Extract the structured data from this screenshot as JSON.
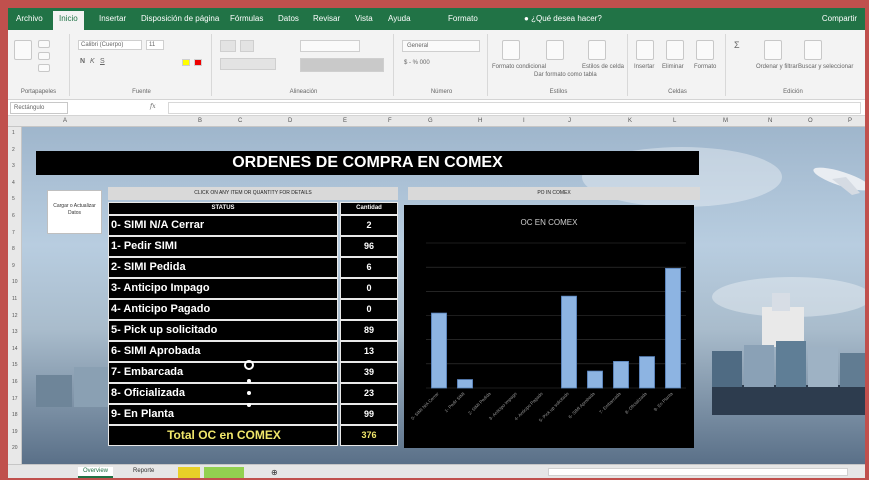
{
  "ribbon_tabs": [
    "Archivo",
    "Inicio",
    "Insertar",
    "Disposición de página",
    "Fórmulas",
    "Datos",
    "Revisar",
    "Vista",
    "Ayuda",
    "Formato"
  ],
  "tell_me": "¿Qué desea hacer?",
  "share": "Compartir",
  "ribbon_groups": [
    "Portapapeles",
    "Fuente",
    "Alineación",
    "Número",
    "Estilos",
    "Celdas",
    "Edición"
  ],
  "ribbon": {
    "font_name": "Calibri (Cuerpo)",
    "font_size": "11",
    "number_format": "General",
    "styles_buttons": [
      "Formato condicional",
      "Dar formato como tabla",
      "Estilos de celda"
    ],
    "cells_buttons": [
      "Insertar",
      "Eliminar",
      "Formato"
    ],
    "edit_buttons": [
      "Ordenar y filtrar",
      "Buscar y seleccionar"
    ]
  },
  "formula_bar": {
    "name_box": "Rectángulo",
    "fx": "fx",
    "value": ""
  },
  "columns": [
    "A",
    "B",
    "C",
    "D",
    "E",
    "F",
    "G",
    "H",
    "I",
    "J",
    "K",
    "L",
    "M",
    "N",
    "O",
    "P"
  ],
  "rows": [
    "1",
    "2",
    "3",
    "4",
    "5",
    "6",
    "7",
    "8",
    "9",
    "10",
    "11",
    "12",
    "13",
    "14",
    "15",
    "16",
    "17",
    "18",
    "19",
    "20"
  ],
  "sheet": {
    "title": "ORDENES DE COMPRA EN COMEX",
    "update_button": "Cargar o Actualizar Datos",
    "table_caption": "CLICK ON ANY ITEM OR QUANTITY FOR DETAILS",
    "chart_caption": "PO IN COMEX",
    "table_header": {
      "status": "STATUS",
      "qty": "Cantidad"
    },
    "table_rows": [
      {
        "status": "0- SIMI N/A Cerrar",
        "qty": "2"
      },
      {
        "status": "1- Pedir SIMI",
        "qty": "96"
      },
      {
        "status": "2- SIMI Pedida",
        "qty": "6"
      },
      {
        "status": "3- Anticipo Impago",
        "qty": "0"
      },
      {
        "status": "4- Anticipo Pagado",
        "qty": "0"
      },
      {
        "status": "5- Pick up solicitado",
        "qty": "89"
      },
      {
        "status": "6- SIMI Aprobada",
        "qty": "13"
      },
      {
        "status": "7- Embarcada",
        "qty": "39"
      },
      {
        "status": "8- Oficializada",
        "qty": "23"
      },
      {
        "status": "9- En Planta",
        "qty": "99"
      }
    ],
    "total": {
      "label": "Total OC en COMEX",
      "value": "376"
    }
  },
  "chart_data": {
    "type": "bar",
    "title": "OC EN COMEX",
    "categories": [
      "0- SIMI N/A Cerrar",
      "1- Pedir SIMI",
      "2- SIMI Pedida",
      "3- Anticipo Impago",
      "4- Anticipo Pagado",
      "5- Pick up solicitado",
      "6- SIMI Aprobada",
      "7- Embarcada",
      "8- Oficializada",
      "9- En Planta"
    ],
    "values": [
      62,
      7,
      0,
      0,
      0,
      76,
      14,
      22,
      26,
      99
    ],
    "ylim": [
      0,
      120
    ],
    "grid": true,
    "legend": "none",
    "bar_color": "#8db4e2",
    "bar_color_dark": "#5b86bf"
  },
  "sheet_tabs": [
    "Overview",
    "Reporte",
    "",
    ""
  ],
  "colors": {
    "excel_green": "#217346",
    "title_bg": "#000000",
    "total_text": "#f0e66b"
  }
}
